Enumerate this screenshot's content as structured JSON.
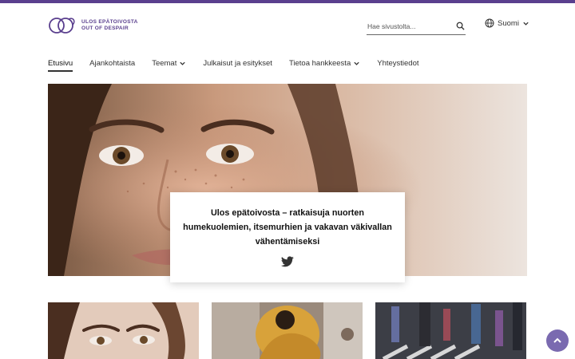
{
  "brand": {
    "line1": "ULOS EPÄTOIVOSTA",
    "line2": "OUT OF DESPAIR",
    "accent": "#5a3f8e"
  },
  "search": {
    "placeholder": "Hae sivustolta...",
    "icon": "search-icon"
  },
  "language": {
    "label": "Suomi",
    "icon": "globe-icon"
  },
  "nav": {
    "items": [
      {
        "label": "Etusivu",
        "active": true,
        "dropdown": false
      },
      {
        "label": "Ajankohtaista",
        "active": false,
        "dropdown": false
      },
      {
        "label": "Teemat",
        "active": false,
        "dropdown": true
      },
      {
        "label": "Julkaisut ja esitykset",
        "active": false,
        "dropdown": false
      },
      {
        "label": "Tietoa hankkeesta",
        "active": false,
        "dropdown": true
      },
      {
        "label": "Yhteystiedot",
        "active": false,
        "dropdown": false
      }
    ]
  },
  "hero": {
    "title": "Ulos epätoivosta – ratkaisuja nuorten humekuolemien, itsemurhien ja vakavan väkivallan vähentämiseksi",
    "share_icon": "twitter-icon"
  },
  "scroll_top": {
    "icon": "chevron-up-icon",
    "color": "#7a6ab0"
  }
}
